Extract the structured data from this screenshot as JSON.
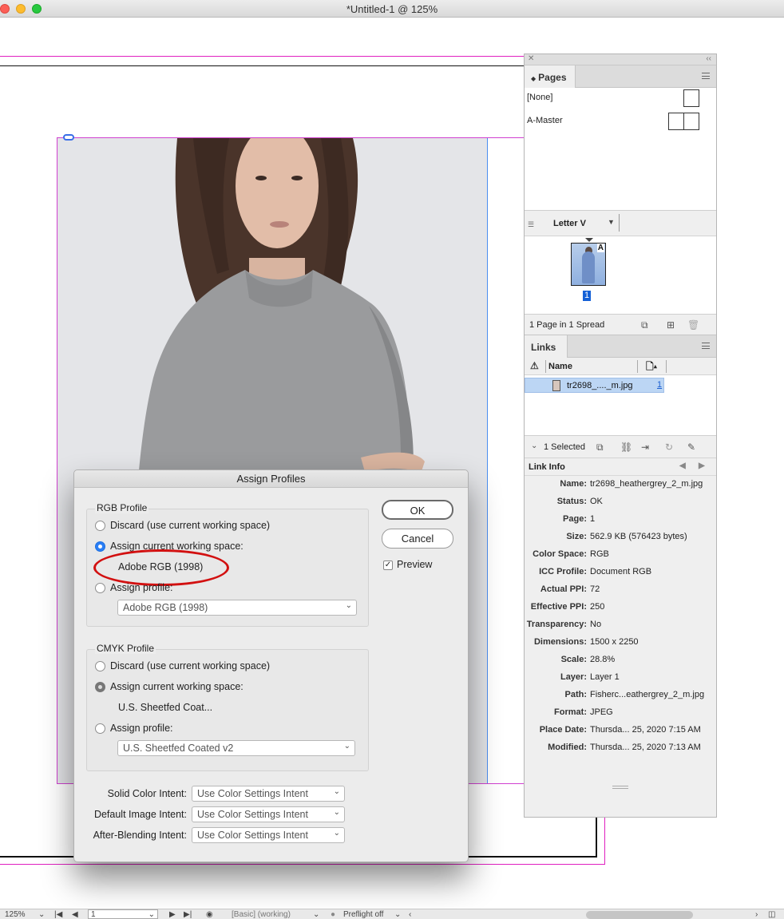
{
  "window": {
    "title": "*Untitled-1 @ 125%"
  },
  "pages_panel": {
    "tab_label": "Pages",
    "tab_arrows": "⌃⌄",
    "masters": [
      {
        "label": "[None]"
      },
      {
        "label": "A-Master"
      }
    ],
    "page_size": "Letter V",
    "spread_master_letter": "A",
    "page_number": "1",
    "footer_text": "1 Page in 1 Spread"
  },
  "links_panel": {
    "tab_label": "Links",
    "column_name": "Name",
    "link": {
      "name": "tr2698_...._m.jpg",
      "page": "1"
    },
    "selected_text": "1 Selected",
    "link_info_title": "Link Info",
    "info": [
      {
        "key": "Name:",
        "value": "tr2698_heathergrey_2_m.jpg"
      },
      {
        "key": "Status:",
        "value": "OK"
      },
      {
        "key": "Page:",
        "value": "1"
      },
      {
        "key": "Size:",
        "value": "562.9 KB (576423 bytes)"
      },
      {
        "key": "Color Space:",
        "value": "RGB"
      },
      {
        "key": "ICC Profile:",
        "value": "Document RGB"
      },
      {
        "key": "Actual PPI:",
        "value": "72"
      },
      {
        "key": "Effective PPI:",
        "value": "250"
      },
      {
        "key": "Transparency:",
        "value": "No"
      },
      {
        "key": "Dimensions:",
        "value": "1500 x 2250"
      },
      {
        "key": "Scale:",
        "value": "28.8%"
      },
      {
        "key": "Layer:",
        "value": "Layer 1"
      },
      {
        "key": "Path:",
        "value": "Fisherc...eathergrey_2_m.jpg"
      },
      {
        "key": "Format:",
        "value": "JPEG"
      },
      {
        "key": "Place Date:",
        "value": "Thursda... 25, 2020 7:15 AM"
      },
      {
        "key": "Modified:",
        "value": "Thursda... 25, 2020 7:13 AM"
      }
    ]
  },
  "dialog": {
    "title": "Assign Profiles",
    "rgb": {
      "group_title": "RGB Profile",
      "discard": "Discard (use current working space)",
      "assign_current": "Assign current working space:",
      "current_value": "Adobe RGB (1998)",
      "assign_profile": "Assign profile:",
      "profile_dropdown": "Adobe RGB (1998)"
    },
    "cmyk": {
      "group_title": "CMYK Profile",
      "discard": "Discard (use current working space)",
      "assign_current": "Assign current working space:",
      "current_value": "U.S. Sheetfed Coat...",
      "assign_profile": "Assign profile:",
      "profile_dropdown": "U.S. Sheetfed Coated v2"
    },
    "intents": [
      {
        "label": "Solid Color Intent:",
        "value": "Use Color Settings Intent"
      },
      {
        "label": "Default Image Intent:",
        "value": "Use Color Settings Intent"
      },
      {
        "label": "After-Blending Intent:",
        "value": "Use Color Settings Intent"
      }
    ],
    "ok_label": "OK",
    "cancel_label": "Cancel",
    "preview_label": "Preview",
    "preview_checked": true
  },
  "statusbar": {
    "zoom": "125%",
    "page_field": "1",
    "profile": "[Basic] (working)",
    "preflight": "Preflight off"
  },
  "colors": {
    "bleed_guide": "#e020c0",
    "frame_blue": "#4a8ef0",
    "selection": "#bcd6f4",
    "highlight_ellipse": "#d21010"
  }
}
